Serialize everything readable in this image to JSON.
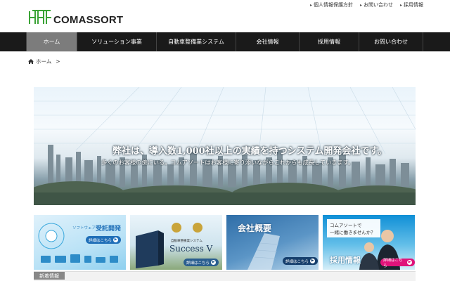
{
  "header": {
    "logo_text": "COMASSORT",
    "links": [
      {
        "label": "個人情報保護方針"
      },
      {
        "label": "お問い合わせ"
      },
      {
        "label": "採用情報"
      }
    ]
  },
  "nav": {
    "items": [
      {
        "label": "ホーム",
        "active": true
      },
      {
        "label": "ソリューション事業"
      },
      {
        "label": "自動車整備業システム"
      },
      {
        "label": "会社情報"
      },
      {
        "label": "採用情報"
      },
      {
        "label": "お問い合わせ"
      }
    ]
  },
  "breadcrumb": {
    "home": "ホーム",
    "separator": ">"
  },
  "hero": {
    "title": "弊社は、導入数1,000社以上の実績を持つシステム開発会社です。",
    "subtitle": "多くのお客様の傍にいる。コムアソートはお客様に寄り添いながらこれからも成長していきます。"
  },
  "banners": [
    {
      "small": "ソフトウェア",
      "title": "受託開発",
      "button": "詳細はこちら"
    },
    {
      "small": "自動車整備業システム",
      "title": "Success V",
      "button": "詳細はこちら"
    },
    {
      "title": "会社概要",
      "button": "詳細はこちら"
    },
    {
      "question_line1": "コムアソートで",
      "question_line2": "一緒に働きませんか？",
      "title": "採用情報",
      "button": "詳細はこちら"
    }
  ],
  "news": {
    "label": "新着情報"
  },
  "colors": {
    "nav_bg": "#1a1a1a",
    "nav_active": "#7c7c7c",
    "logo_green": "#3aa335",
    "button_blue": "#1f6fb8",
    "button_pink": "#e0137a"
  }
}
